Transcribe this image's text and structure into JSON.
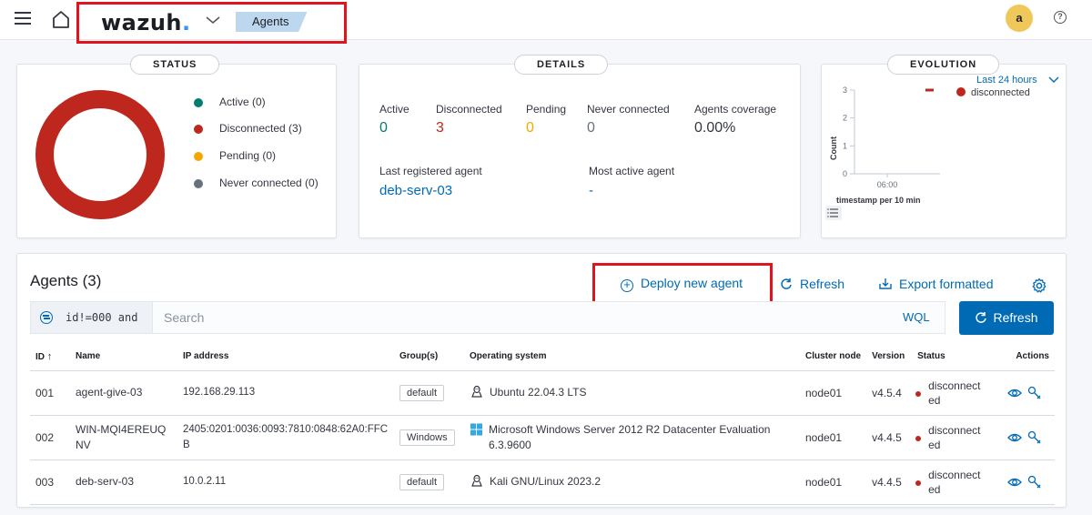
{
  "header": {
    "logo_text": "wazuh",
    "logo_dot": ".",
    "breadcrumb": "Agents",
    "avatar_initial": "a",
    "help_symbol": "?"
  },
  "status_panel": {
    "title": "STATUS",
    "legend": [
      {
        "label": "Active (0)",
        "color": "#017d73"
      },
      {
        "label": "Disconnected (3)",
        "color": "#bd271e"
      },
      {
        "label": "Pending (0)",
        "color": "#f5a700"
      },
      {
        "label": "Never connected (0)",
        "color": "#69707d"
      }
    ]
  },
  "details_panel": {
    "title": "DETAILS",
    "stats": [
      {
        "label": "Active",
        "value": "0",
        "color": "#017d73"
      },
      {
        "label": "Disconnected",
        "value": "3",
        "color": "#bd271e"
      },
      {
        "label": "Pending",
        "value": "0",
        "color": "#f5a700"
      },
      {
        "label": "Never connected",
        "value": "0",
        "color": "#69707d"
      },
      {
        "label": "Agents coverage",
        "value": "0.00%",
        "color": "#343741"
      }
    ],
    "last_registered_label": "Last registered agent",
    "last_registered_value": "deb-serv-03",
    "most_active_label": "Most active agent",
    "most_active_value": "-"
  },
  "evolution_panel": {
    "title": "EVOLUTION",
    "range": "Last 24 hours",
    "legend": "disconnected",
    "y_label": "Count",
    "x_label": "timestamp per 10 min",
    "y_ticks": [
      "3",
      "2",
      "1",
      "0"
    ],
    "x_ticks": [
      "06:00"
    ]
  },
  "chart_data": {
    "type": "line",
    "title": "",
    "xlabel": "timestamp per 10 min",
    "ylabel": "Count",
    "ylim": [
      0,
      3
    ],
    "x_ticks": [
      "06:00"
    ],
    "series": [
      {
        "name": "disconnected",
        "color": "#bd271e",
        "values": [
          3
        ]
      }
    ],
    "legend": "top-right"
  },
  "agents": {
    "title": "Agents (3)",
    "deploy_label": "Deploy new agent",
    "refresh_label": "Refresh",
    "export_label": "Export formatted",
    "search_query": "id!=000 and",
    "search_placeholder": "Search",
    "wql_label": "WQL",
    "refresh_button": "Refresh",
    "columns": [
      "ID",
      "Name",
      "IP address",
      "Group(s)",
      "Operating system",
      "Cluster node",
      "Version",
      "Status",
      "Actions"
    ],
    "sort_arrow": "↑",
    "rows": [
      {
        "id": "001",
        "name": "agent-give-03",
        "ip": "192.168.29.113",
        "group": "default",
        "os": "Ubuntu 22.04.3 LTS",
        "os_icon": "linux-icon",
        "node": "node01",
        "version": "v4.5.4",
        "status": "disconnected"
      },
      {
        "id": "002",
        "name": "WIN-MQI4EREUQNV",
        "ip": "2405:0201:0036:0093:7810:0848:62A0:FFCB",
        "group": "Windows",
        "os": "Microsoft Windows Server 2012 R2 Datacenter Evaluation 6.3.9600",
        "os_icon": "windows-icon",
        "node": "node01",
        "version": "v4.4.5",
        "status": "disconnected"
      },
      {
        "id": "003",
        "name": "deb-serv-03",
        "ip": "10.0.2.11",
        "group": "default",
        "os": "Kali GNU/Linux 2023.2",
        "os_icon": "linux-icon",
        "node": "node01",
        "version": "v4.4.5",
        "status": "disconnected"
      }
    ]
  }
}
